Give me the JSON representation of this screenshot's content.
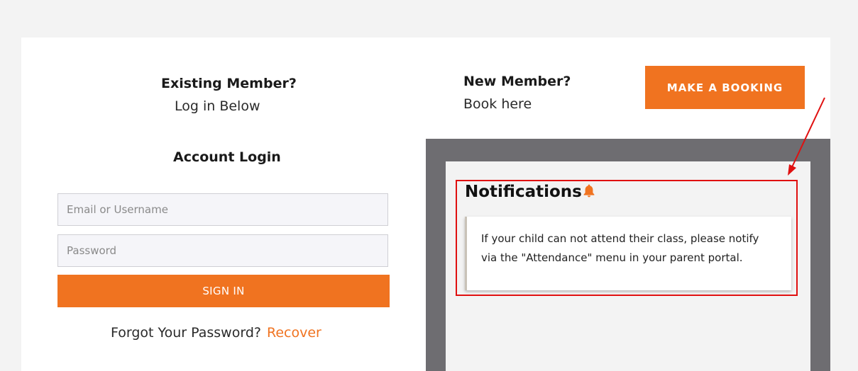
{
  "existing": {
    "title": "Existing Member?",
    "subtitle": "Log in Below"
  },
  "login": {
    "title": "Account Login",
    "email_placeholder": "Email or Username",
    "password_placeholder": "Password",
    "signin_label": "SIGN IN",
    "forgot_text": "Forgot Your Password?",
    "recover_label": "Recover"
  },
  "new_member": {
    "title": "New Member?",
    "subtitle": "Book here",
    "booking_label": "MAKE A BOOKING"
  },
  "notifications": {
    "title": "Notifications",
    "icon": "bell-icon",
    "message": "If your child can not attend their class, please notify via the \"Attendance\" menu in your parent portal."
  },
  "colors": {
    "accent": "#f07320",
    "frame": "#6e6d71",
    "annotation": "#e01010"
  }
}
